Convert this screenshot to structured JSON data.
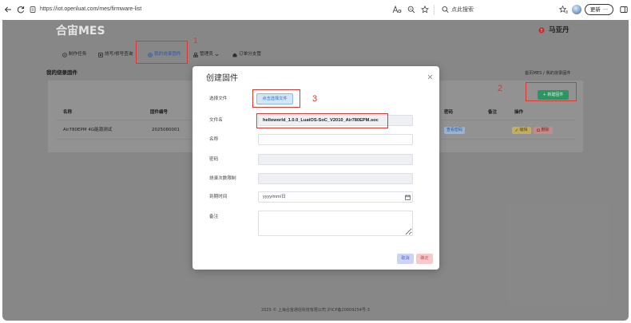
{
  "browser": {
    "url": "https://iot.openluat.com/mes/firmware-list",
    "search_placeholder": "点此搜索",
    "update_label": "更新",
    "more_label": "···",
    "icons": [
      "back-icon",
      "refresh-icon",
      "site-info-icon",
      "read-aloud-icon",
      "zoom-icon",
      "favorite-icon",
      "search-icon",
      "favorites-icon",
      "profile-avatar",
      "sidebar-icon"
    ]
  },
  "header": {
    "logo": "合宙MES",
    "user": "马亚丹",
    "user_icon": "alert-icon"
  },
  "nav": [
    {
      "label": "制作任务",
      "icon": "task-icon"
    },
    {
      "label": "烧写/修号查询",
      "icon": "query-icon"
    },
    {
      "label": "我的烧录固件",
      "icon": "firmware-icon",
      "active": true
    },
    {
      "label": "管理员",
      "icon": "admin-icon",
      "dropdown": true
    },
    {
      "label": "订单分支管",
      "icon": "branch-icon"
    }
  ],
  "page": {
    "title": "我的烧录固件",
    "breadcrumb": "首页MES / 我的烧录固件",
    "new_button": "+ 新建固件"
  },
  "table": {
    "headers": [
      "名称",
      "固件编号",
      "密码",
      "备注",
      "操作"
    ],
    "rows": [
      {
        "name": "Air780EPM 4G能源测试",
        "code": "2025080001",
        "password_action": "查看密码",
        "edit": "编辑",
        "delete": "删除"
      }
    ]
  },
  "footer": "2025 © 上海合宙通信科技有限公司 沪ICP备20009254号-3",
  "annotations": {
    "step1": "1",
    "step2": "2",
    "step3": "3"
  },
  "modal": {
    "title": "创建固件",
    "fields": {
      "file": {
        "label": "选择文件",
        "button": "点击选择文件"
      },
      "filename": {
        "label": "文件名",
        "value": "helloworld_1.0.0_LuatOS-SoC_V2010_Air780EPM.soc"
      },
      "name": {
        "label": "名称"
      },
      "password": {
        "label": "密码"
      },
      "burn_limit": {
        "label": "烧录次数限制"
      },
      "expiry": {
        "label": "到期时间",
        "placeholder": "yyyy/mm/日"
      },
      "remark": {
        "label": "备注"
      }
    },
    "cancel": "取消",
    "confirm": "确定"
  },
  "colors": {
    "accent_green": "#30a870",
    "annotation_red": "#e3342f",
    "active_blue": "#3160b8",
    "cancel_bg": "#ccd3f3",
    "confirm_bg": "#f6c9cd"
  }
}
